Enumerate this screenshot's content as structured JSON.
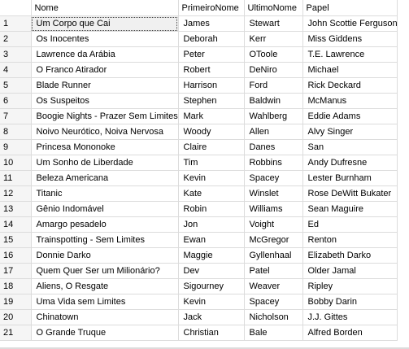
{
  "columns": {
    "idx": "",
    "nome": "Nome",
    "primeiro": "PrimeiroNome",
    "ultimo": "UltimoNome",
    "papel": "Papel"
  },
  "rows": [
    {
      "n": "1",
      "nome": "Um Corpo que Cai",
      "primeiro": "James",
      "ultimo": "Stewart",
      "papel": "John Scottie Ferguson"
    },
    {
      "n": "2",
      "nome": "Os Inocentes",
      "primeiro": "Deborah",
      "ultimo": "Kerr",
      "papel": "Miss Giddens"
    },
    {
      "n": "3",
      "nome": "Lawrence da Arábia",
      "primeiro": "Peter",
      "ultimo": "OToole",
      "papel": "T.E. Lawrence"
    },
    {
      "n": "4",
      "nome": "O Franco Atirador",
      "primeiro": "Robert",
      "ultimo": "DeNiro",
      "papel": "Michael"
    },
    {
      "n": "5",
      "nome": "Blade Runner",
      "primeiro": "Harrison",
      "ultimo": "Ford",
      "papel": "Rick Deckard"
    },
    {
      "n": "6",
      "nome": "Os Suspeitos",
      "primeiro": "Stephen",
      "ultimo": "Baldwin",
      "papel": "McManus"
    },
    {
      "n": "7",
      "nome": "Boogie Nights - Prazer Sem Limites",
      "primeiro": "Mark",
      "ultimo": "Wahlberg",
      "papel": "Eddie Adams"
    },
    {
      "n": "8",
      "nome": "Noivo Neurótico, Noiva Nervosa",
      "primeiro": "Woody",
      "ultimo": "Allen",
      "papel": "Alvy Singer"
    },
    {
      "n": "9",
      "nome": "Princesa Mononoke",
      "primeiro": "Claire",
      "ultimo": "Danes",
      "papel": "San"
    },
    {
      "n": "10",
      "nome": "Um Sonho de Liberdade",
      "primeiro": "Tim",
      "ultimo": "Robbins",
      "papel": "Andy Dufresne"
    },
    {
      "n": "11",
      "nome": "Beleza Americana",
      "primeiro": "Kevin",
      "ultimo": "Spacey",
      "papel": "Lester Burnham"
    },
    {
      "n": "12",
      "nome": "Titanic",
      "primeiro": "Kate",
      "ultimo": "Winslet",
      "papel": "Rose DeWitt Bukater"
    },
    {
      "n": "13",
      "nome": "Gênio Indomável",
      "primeiro": "Robin",
      "ultimo": "Williams",
      "papel": "Sean Maguire"
    },
    {
      "n": "14",
      "nome": "Amargo pesadelo",
      "primeiro": "Jon",
      "ultimo": "Voight",
      "papel": "Ed"
    },
    {
      "n": "15",
      "nome": "Trainspotting - Sem Limites",
      "primeiro": "Ewan",
      "ultimo": "McGregor",
      "papel": "Renton"
    },
    {
      "n": "16",
      "nome": "Donnie Darko",
      "primeiro": "Maggie",
      "ultimo": "Gyllenhaal",
      "papel": "Elizabeth Darko"
    },
    {
      "n": "17",
      "nome": "Quem Quer Ser um Milionário?",
      "primeiro": "Dev",
      "ultimo": "Patel",
      "papel": "Older Jamal"
    },
    {
      "n": "18",
      "nome": "Aliens, O Resgate",
      "primeiro": "Sigourney",
      "ultimo": "Weaver",
      "papel": "Ripley"
    },
    {
      "n": "19",
      "nome": "Uma Vida sem Limites",
      "primeiro": "Kevin",
      "ultimo": "Spacey",
      "papel": "Bobby Darin"
    },
    {
      "n": "20",
      "nome": "Chinatown",
      "primeiro": "Jack",
      "ultimo": "Nicholson",
      "papel": "J.J. Gittes"
    },
    {
      "n": "21",
      "nome": "O Grande Truque",
      "primeiro": "Christian",
      "ultimo": "Bale",
      "papel": "Alfred Borden"
    }
  ]
}
